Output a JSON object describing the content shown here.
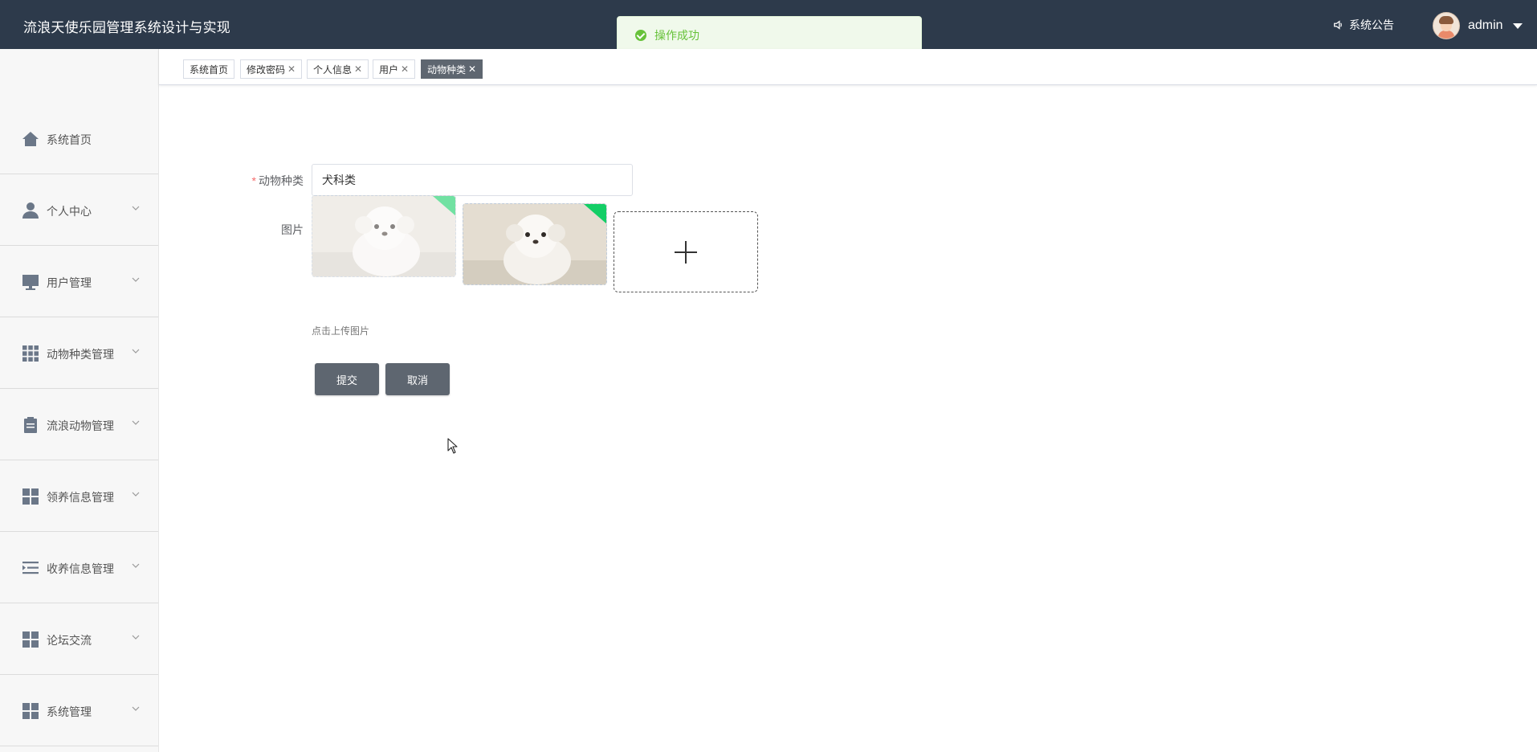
{
  "header": {
    "title": "流浪天使乐园管理系统设计与实现",
    "notice_label": "系统公告",
    "notice_icon": "speaker-icon",
    "username": "admin",
    "background": "#2d3a4b"
  },
  "toast": {
    "message": "操作成功",
    "icon": "success-check-icon",
    "color": "#67c23a"
  },
  "sidebar": {
    "items": [
      {
        "label": "系统首页",
        "icon": "home-icon",
        "has_submenu": false
      },
      {
        "label": "个人中心",
        "icon": "user-icon",
        "has_submenu": true
      },
      {
        "label": "用户管理",
        "icon": "monitor-icon",
        "has_submenu": true
      },
      {
        "label": "动物种类管理",
        "icon": "grid-icon",
        "has_submenu": true
      },
      {
        "label": "流浪动物管理",
        "icon": "clipboard-icon",
        "has_submenu": true
      },
      {
        "label": "领养信息管理",
        "icon": "dashboard-icon",
        "has_submenu": true
      },
      {
        "label": "收养信息管理",
        "icon": "list-indent-icon",
        "has_submenu": true
      },
      {
        "label": "论坛交流",
        "icon": "dashboard-icon",
        "has_submenu": true
      },
      {
        "label": "系统管理",
        "icon": "dashboard-icon",
        "has_submenu": true
      }
    ]
  },
  "tabs": [
    {
      "label": "系统首页",
      "closable": false,
      "active": false
    },
    {
      "label": "修改密码",
      "closable": true,
      "active": false
    },
    {
      "label": "个人信息",
      "closable": true,
      "active": false
    },
    {
      "label": "用户",
      "closable": true,
      "active": false
    },
    {
      "label": "动物种类",
      "closable": true,
      "active": true
    }
  ],
  "form": {
    "category_label": "动物种类",
    "category_value": "犬科类",
    "image_label": "图片",
    "upload_tip": "点击上传图片",
    "submit_label": "提交",
    "cancel_label": "取消",
    "accent": "#5e6670"
  }
}
